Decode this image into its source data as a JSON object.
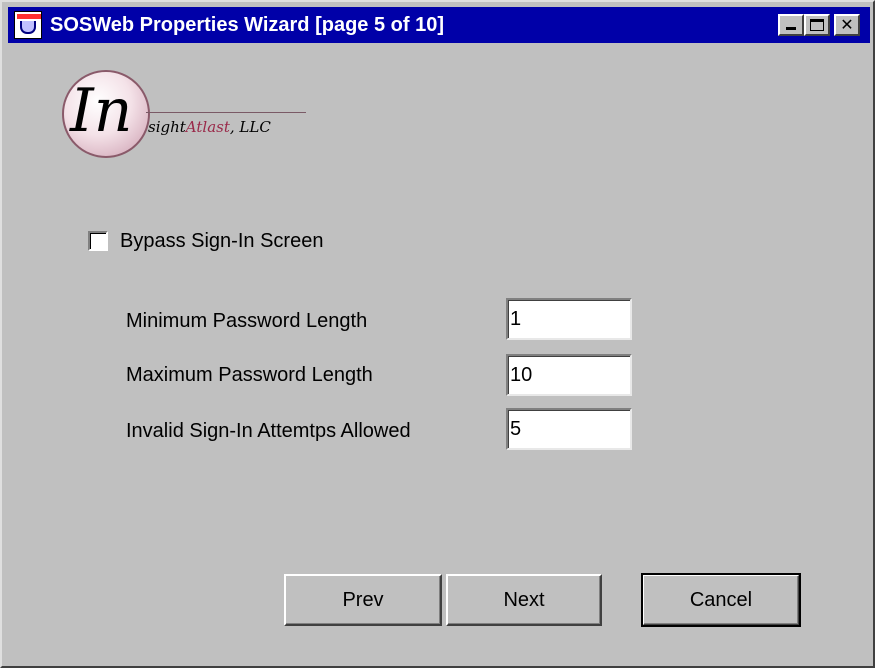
{
  "window": {
    "title": "SOSWeb Properties Wizard  [page 5 of 10]",
    "icons": {
      "app": "java-cup-icon",
      "minimize": "minimize-icon",
      "maximize": "maximize-icon",
      "close": "close-icon"
    },
    "close_glyph": "✕"
  },
  "logo": {
    "initials": "In",
    "suffix_prefix": "sight",
    "suffix_brand": "Atlast",
    "suffix_company": ", LLC"
  },
  "bypass": {
    "label": "Bypass Sign-In Screen",
    "checked": false
  },
  "fields": [
    {
      "label": "Minimum Password Length",
      "value": "1"
    },
    {
      "label": "Maximum Password Length",
      "value": "10"
    },
    {
      "label": "Invalid Sign-In Attemtps Allowed",
      "value": "5"
    }
  ],
  "buttons": {
    "prev": "Prev",
    "next": "Next",
    "cancel": "Cancel"
  },
  "colors": {
    "titlebar": "#0000a8",
    "background": "#c0c0c0"
  }
}
